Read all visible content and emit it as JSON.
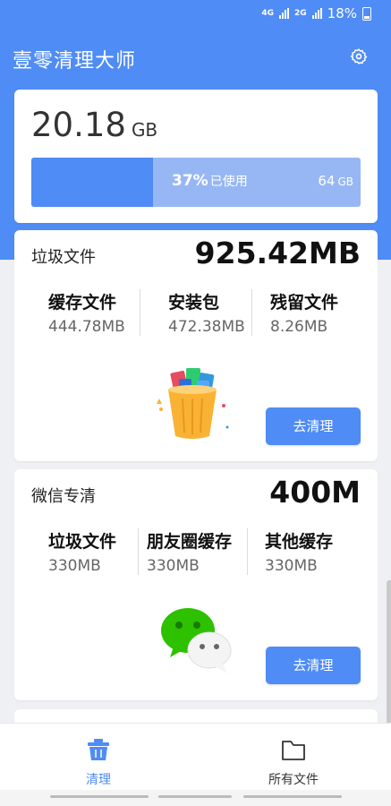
{
  "status": {
    "net1": "4G",
    "net2": "2G",
    "battery": "18%"
  },
  "app": {
    "title": "壹零清理大师"
  },
  "storage": {
    "size": "20.18",
    "unit": "GB",
    "used_percent": 37,
    "used_label": "37%",
    "used_suffix": "已使用",
    "total": "64",
    "total_unit": "GB"
  },
  "junk": {
    "title": "垃圾文件",
    "total": "925.42MB",
    "items": [
      {
        "label": "缓存文件",
        "value": "444.78MB"
      },
      {
        "label": "安装包",
        "value": "472.38MB"
      },
      {
        "label": "残留文件",
        "value": "8.26MB"
      }
    ],
    "button": "去清理"
  },
  "wechat": {
    "title": "微信专清",
    "total": "400M",
    "items": [
      {
        "label": "垃圾文件",
        "value": "330MB"
      },
      {
        "label": "朋友圈缓存",
        "value": "330MB"
      },
      {
        "label": "其他缓存",
        "value": "330MB"
      }
    ],
    "button": "去清理"
  },
  "nav": {
    "clean": "清理",
    "files": "所有文件"
  },
  "colors": {
    "accent": "#4f8cf5",
    "bar_bg": "#97b7f4"
  },
  "icons": [
    "settings-gear-icon",
    "trash-bin-illustration",
    "wechat-bubbles-illustration",
    "broom-bin-icon",
    "folder-icon"
  ]
}
